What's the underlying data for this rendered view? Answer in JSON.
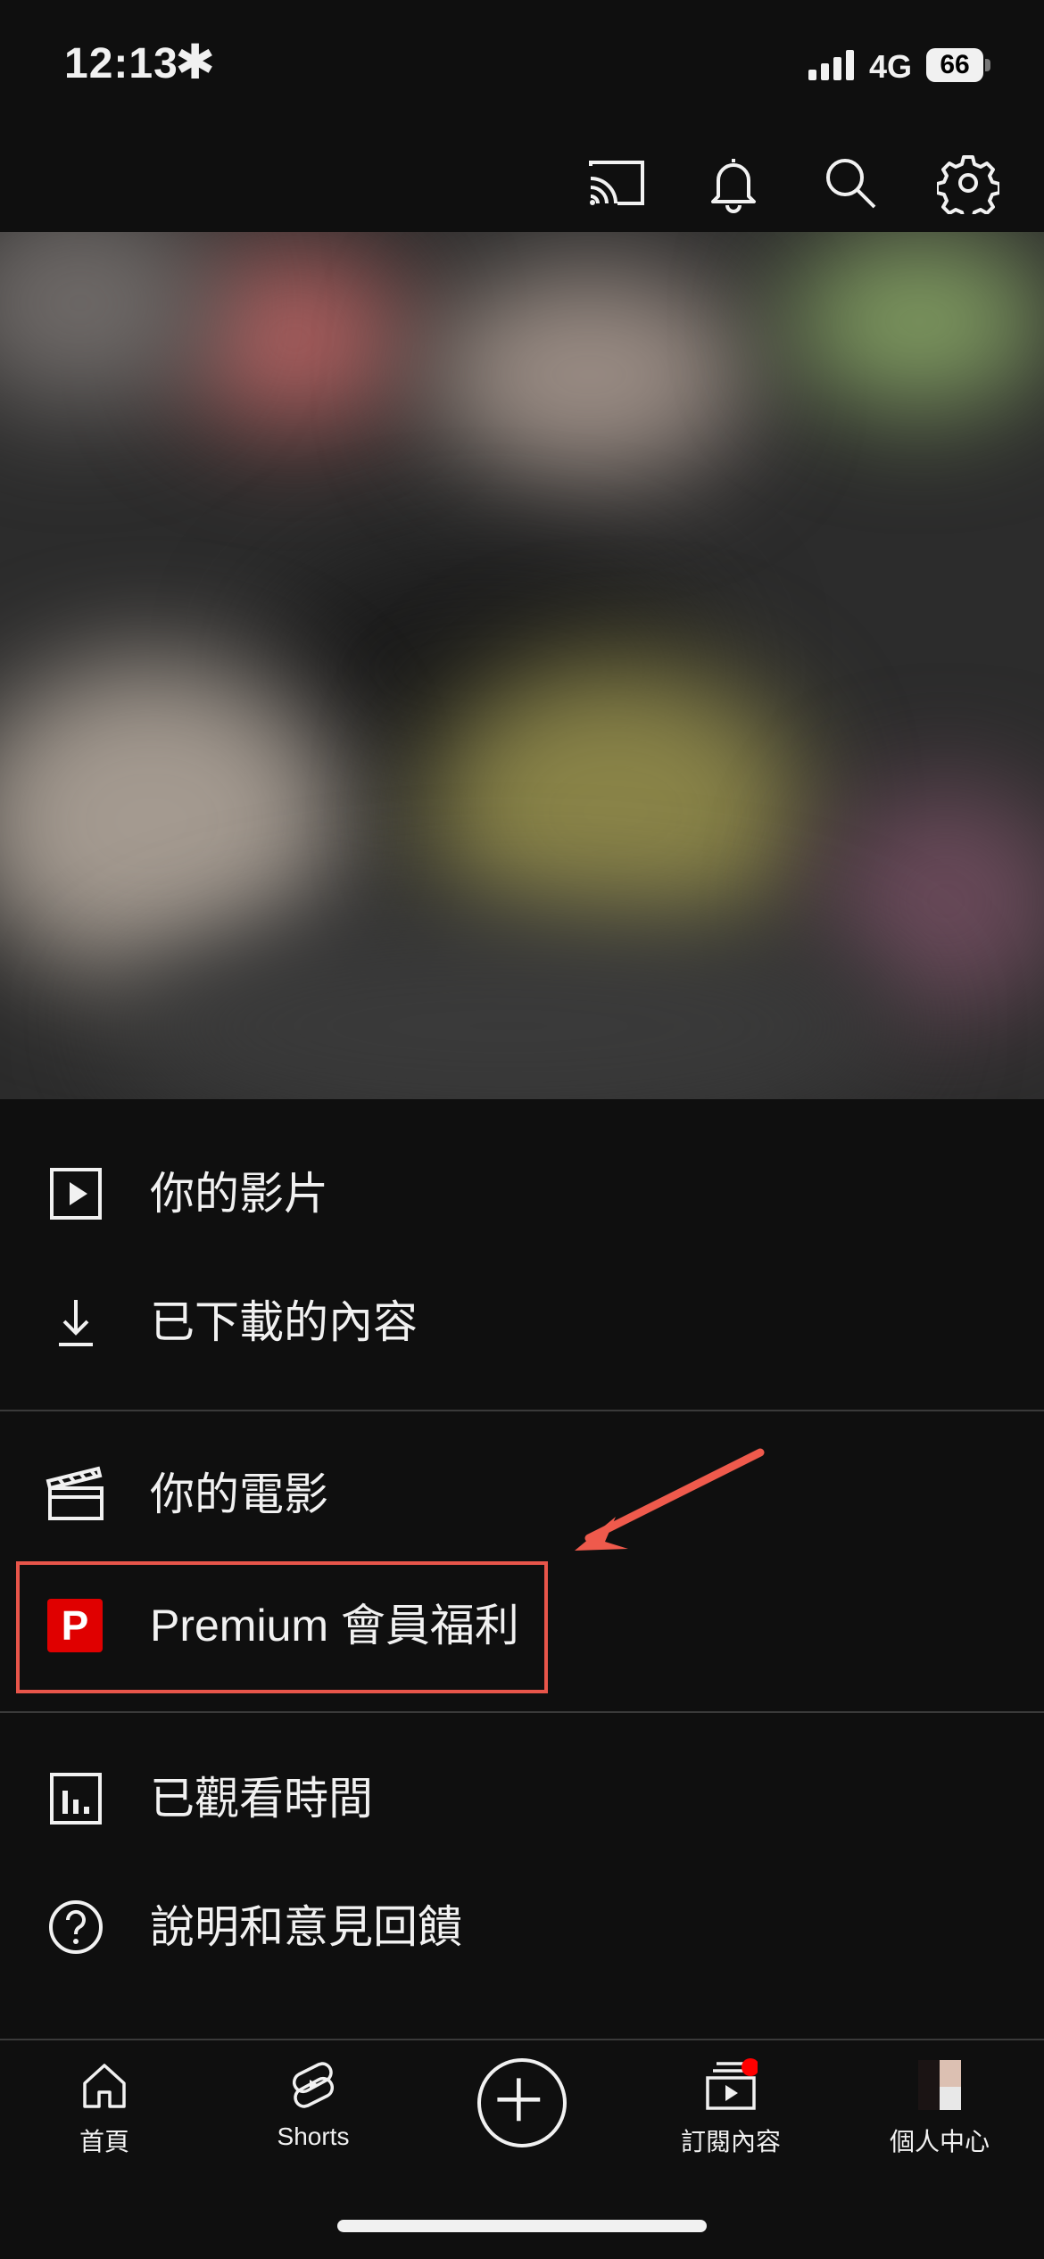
{
  "status": {
    "time": "12:13",
    "extra": "✱",
    "network": "4G",
    "battery": "66"
  },
  "menu": {
    "items": [
      {
        "label": "你的影片",
        "icon": "play-square-icon"
      },
      {
        "label": "已下載的內容",
        "icon": "download-icon"
      },
      {
        "label": "你的電影",
        "icon": "clapperboard-icon"
      },
      {
        "label": "Premium 會員福利",
        "icon": "premium-p-icon"
      },
      {
        "label": "已觀看時間",
        "icon": "bar-chart-icon"
      },
      {
        "label": "說明和意見回饋",
        "icon": "help-circle-icon"
      }
    ]
  },
  "nav": {
    "home": "首頁",
    "shorts": "Shorts",
    "subscriptions": "訂閱內容",
    "you": "個人中心"
  },
  "colors": {
    "background": "#0f0f0f",
    "accent": "#ff0000",
    "highlight": "#e8554a"
  }
}
